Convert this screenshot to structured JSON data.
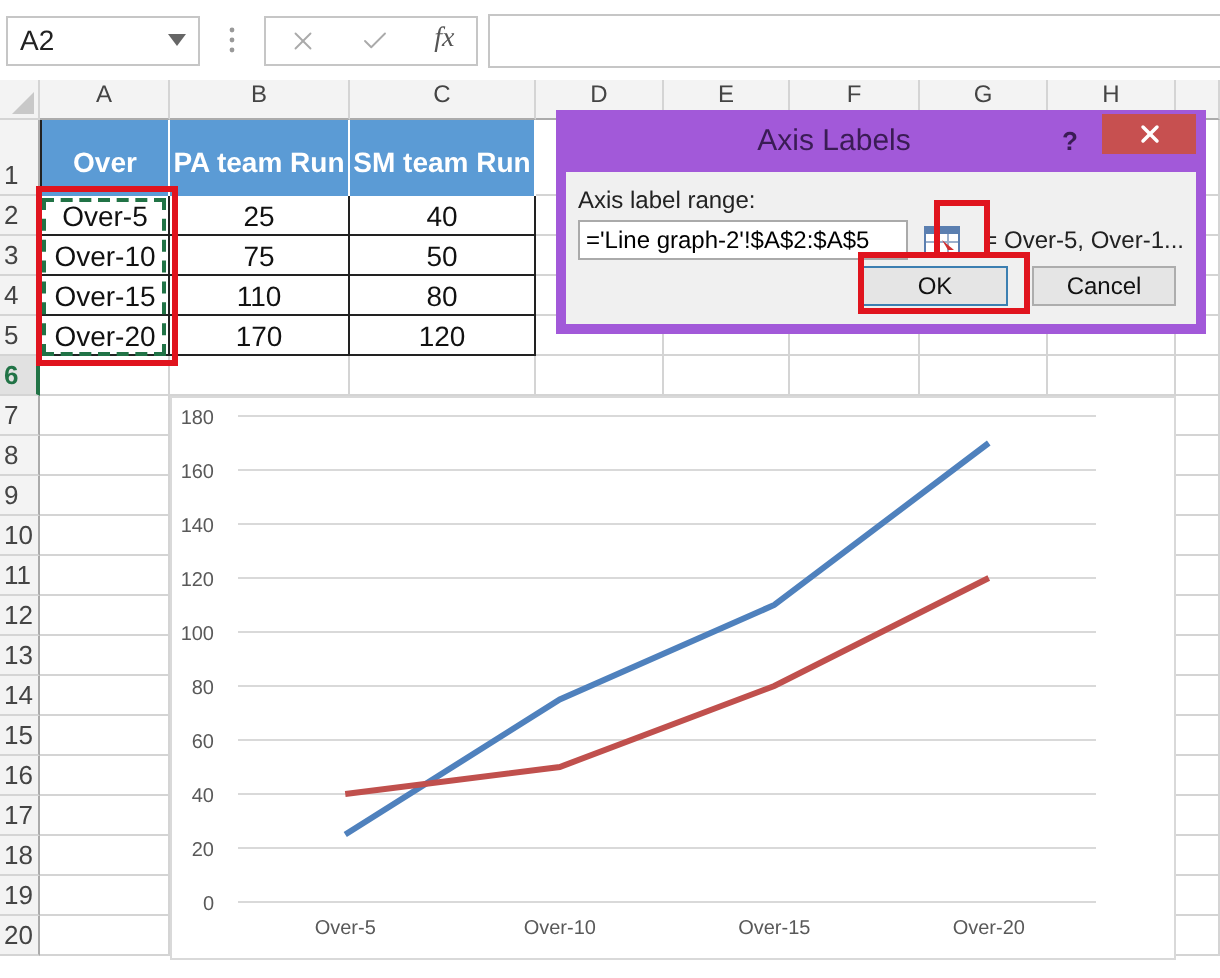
{
  "formula_bar": {
    "name_box": "A2",
    "function_label": "fx"
  },
  "sheet": {
    "columns": [
      "A",
      "B",
      "C",
      "D",
      "E",
      "F",
      "G",
      "H"
    ],
    "rows": [
      {
        "label": "1",
        "selected": false
      },
      {
        "label": "2",
        "selected": false
      },
      {
        "label": "3",
        "selected": false
      },
      {
        "label": "4",
        "selected": false
      },
      {
        "label": "5",
        "selected": false
      },
      {
        "label": "6",
        "selected": true
      },
      {
        "label": "7",
        "selected": false
      },
      {
        "label": "8",
        "selected": false
      },
      {
        "label": "9",
        "selected": false
      },
      {
        "label": "10",
        "selected": false
      },
      {
        "label": "11",
        "selected": false
      },
      {
        "label": "12",
        "selected": false
      },
      {
        "label": "13",
        "selected": false
      },
      {
        "label": "14",
        "selected": false
      },
      {
        "label": "15",
        "selected": false
      },
      {
        "label": "16",
        "selected": false
      },
      {
        "label": "17",
        "selected": false
      },
      {
        "label": "18",
        "selected": false
      },
      {
        "label": "19",
        "selected": false
      },
      {
        "label": "20",
        "selected": false
      }
    ],
    "table": {
      "headers": [
        "Over",
        "PA team Run",
        "SM team Run"
      ],
      "rows": [
        [
          "Over-5",
          "25",
          "40"
        ],
        [
          "Over-10",
          "75",
          "50"
        ],
        [
          "Over-15",
          "110",
          "80"
        ],
        [
          "Over-20",
          "170",
          "120"
        ]
      ]
    }
  },
  "chart": {
    "chart_data": {
      "type": "line",
      "grid": true,
      "categories": [
        "Over-5",
        "Over-10",
        "Over-15",
        "Over-20"
      ],
      "ylim": [
        0,
        180
      ],
      "yticks": [
        0,
        20,
        40,
        60,
        80,
        100,
        120,
        140,
        160,
        180
      ],
      "series": [
        {
          "color": "#4f81bd",
          "values": [
            25,
            75,
            110,
            170
          ]
        },
        {
          "color": "#c0504d",
          "values": [
            40,
            50,
            80,
            120
          ]
        }
      ]
    }
  },
  "dialog": {
    "title": "Axis Labels",
    "help": "?",
    "field_label": "Axis label range:",
    "field_value": "='Line graph-2'!$A$2:$A$5",
    "preview": "= Over-5, Over-1...",
    "buttons": [
      "OK",
      "Cancel"
    ]
  }
}
